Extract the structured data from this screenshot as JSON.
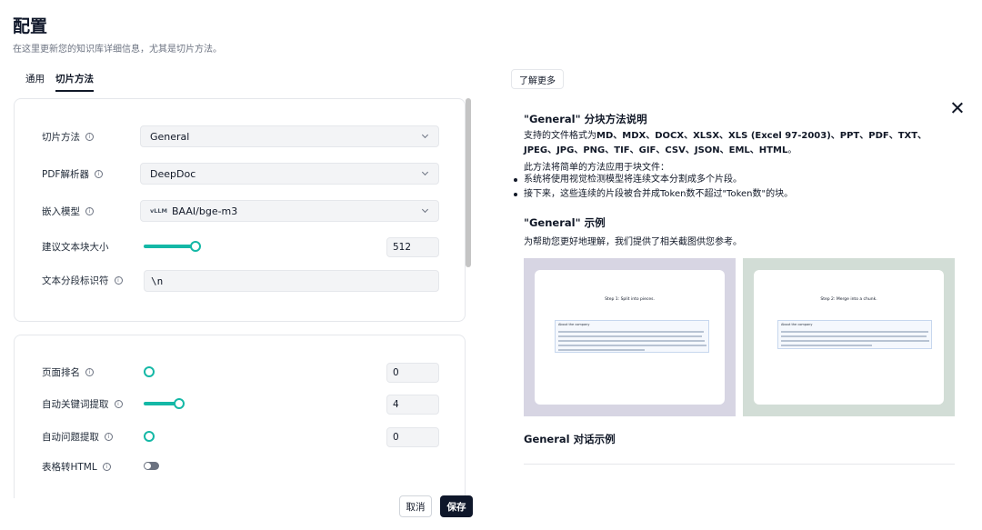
{
  "header": {
    "title": "配置",
    "subtitle": "在这里更新您的知识库详细信息，尤其是切片方法。"
  },
  "tabs": [
    {
      "label": "通用",
      "active": false
    },
    {
      "label": "切片方法",
      "active": true
    }
  ],
  "form": {
    "chunk_method": {
      "label": "切片方法",
      "value": "General"
    },
    "pdf_parser": {
      "label": "PDF解析器",
      "value": "DeepDoc"
    },
    "embedding_model": {
      "label": "嵌入模型",
      "badge": "vLLM",
      "value": "BAAI/bge-m3"
    },
    "chunk_size": {
      "label": "建议文本块大小",
      "value": "512",
      "fill": 0.19
    },
    "delimiter": {
      "label": "文本分段标识符",
      "value": "\\n"
    },
    "page_rank": {
      "label": "页面排名",
      "value": "0",
      "fill": 0
    },
    "auto_keywords": {
      "label": "自动关键词提取",
      "value": "4",
      "fill": 0.13
    },
    "auto_questions": {
      "label": "自动问题提取",
      "value": "0",
      "fill": 0
    },
    "table_to_html": {
      "label": "表格转HTML",
      "enabled": false
    }
  },
  "actions": {
    "cancel": "取消",
    "save": "保存"
  },
  "right_panel": {
    "learn_more": "了解更多",
    "method_title": "\"General\" 分块方法说明",
    "formats_prefix": "支持的文件格式为",
    "formats": "MD、MDX、DOCX、XLSX、XLS (Excel 97-2003)、PPT、PDF、TXT、JPEG、JPG、PNG、TIF、GIF、CSV、JSON、EML、HTML",
    "formats_suffix": "。",
    "intro": "此方法将简单的方法应用于块文件：",
    "bullets": [
      "系统将使用视觉检测模型将连续文本分割成多个片段。",
      "接下来，这些连续的片段被合并成Token数不超过\"Token数\"的块。"
    ],
    "example_title": "\"General\" 示例",
    "example_desc": "为帮助您更好地理解，我们提供了相关截图供您参考。",
    "screenshots": [
      {
        "title": "Step 1: Split into pieces.",
        "heading": "About the company"
      },
      {
        "title": "Step 2: Merge into a chunk.",
        "heading": "About the company"
      }
    ],
    "chat_title": "General 对话示例"
  },
  "colors": {
    "accent": "#14b8a6",
    "primary_button": "#0f172a",
    "screenshot1_bg": "#d7d5e3",
    "screenshot2_bg": "#d2ddd6"
  }
}
